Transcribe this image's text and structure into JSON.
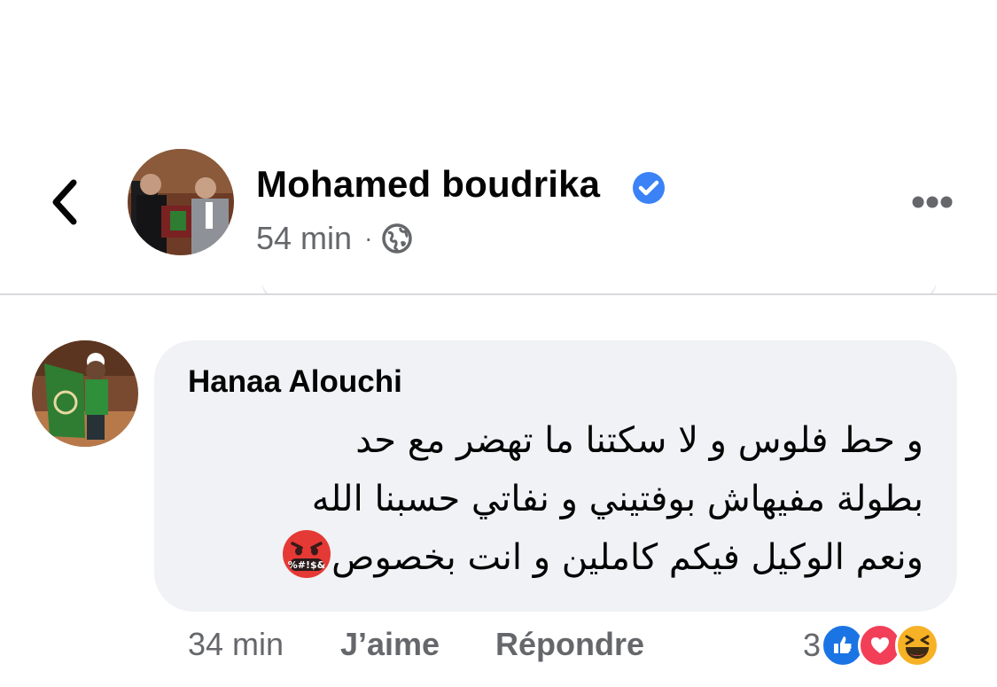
{
  "post_header": {
    "author_name": "Mohamed boudrika",
    "post_age": "54 min",
    "separator": "·",
    "icons": {
      "back": "chevron-left-icon",
      "verified": "verified-badge-icon",
      "audience": "globe-icon",
      "more": "more-options-icon"
    },
    "colors": {
      "verified": "#3b82f6",
      "secondary_text": "#65676b"
    }
  },
  "comment": {
    "author_name": "Hanaa Alouchi",
    "text_lines": [
      "و حط فلوس و لا سكتنا ما تهضر مع  حد",
      "بطولة مفيهاش بوفتيني و نفاتي حسبنا الله",
      "ونعم الوكيل فيكم كاملين و انت بخصوص"
    ],
    "trailing_emoji": "face-with-symbols-on-mouth-emoji",
    "emoji_symbols": "&$!#%",
    "bubble_color": "#f0f2f5",
    "actions": {
      "time": "34 min",
      "like_label": "J’aime",
      "reply_label": "Répondre"
    },
    "reactions": {
      "count": "3",
      "types": [
        "like-reaction-icon",
        "love-reaction-icon",
        "haha-reaction-icon"
      ],
      "colors": {
        "like": "#1b74e4",
        "love": "#f33e58",
        "haha": "#f7b125"
      }
    }
  }
}
